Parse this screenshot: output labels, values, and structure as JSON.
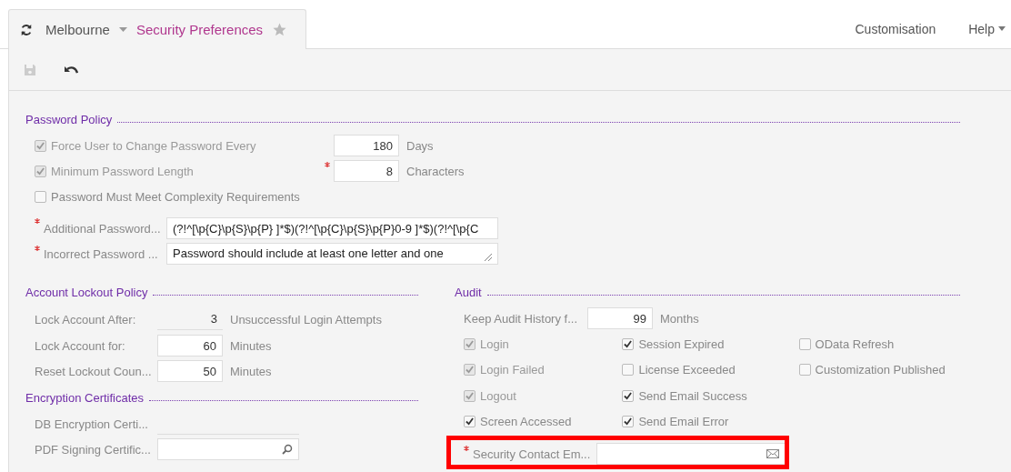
{
  "tab": {
    "location": "Melbourne",
    "title": "Security Preferences",
    "favorite": false
  },
  "top_links": [
    {
      "label": "Customisation",
      "kind": "link"
    },
    {
      "label": "Help",
      "kind": "menu"
    }
  ],
  "toolbar": {
    "save_disabled": true
  },
  "password_policy": {
    "title": "Password Policy",
    "options": [
      {
        "label": "Force User to Change Password Every",
        "checked": true,
        "disabled": true,
        "required": false,
        "value": "180",
        "unit": "Days"
      },
      {
        "label": "Minimum Password Length",
        "checked": true,
        "disabled": true,
        "required": true,
        "value": "8",
        "unit": "Characters"
      },
      {
        "label": "Password Must Meet Complexity Requirements",
        "checked": false,
        "disabled": false
      }
    ],
    "fields": [
      {
        "label": "Additional Password...",
        "required": true,
        "kind": "text",
        "value": "(?!^[\\p{C}\\p{S}\\p{P} ]*$)(?!^[\\p{C}\\p{S}\\p{P}0-9 ]*$)(?!^[\\p{C"
      },
      {
        "label": "Incorrect Password ...",
        "required": true,
        "kind": "textarea",
        "value": "Password should include at least one letter and one"
      }
    ]
  },
  "account_lockout": {
    "title": "Account Lockout Policy",
    "rows": [
      {
        "label": "Lock Account After:",
        "value": "3",
        "unit": "Unsuccessful Login Attempts",
        "kind": "readonly"
      },
      {
        "label": "Lock Account for:",
        "value": "60",
        "unit": "Minutes",
        "kind": "input"
      },
      {
        "label": "Reset Lockout Coun...",
        "value": "50",
        "unit": "Minutes",
        "kind": "input"
      }
    ]
  },
  "encryption": {
    "title": "Encryption Certificates",
    "rows": [
      {
        "label": "DB Encryption Certi...",
        "kind": "readonly"
      },
      {
        "label": "PDF Signing Certific...",
        "kind": "lookup"
      }
    ]
  },
  "audit": {
    "title": "Audit",
    "history": {
      "label": "Keep Audit History f...",
      "value": "99",
      "unit": "Months"
    },
    "event_columns": [
      [
        {
          "label": "Login",
          "checked": true,
          "disabled": true
        },
        {
          "label": "Login Failed",
          "checked": true,
          "disabled": true
        },
        {
          "label": "Logout",
          "checked": true,
          "disabled": true
        },
        {
          "label": "Screen Accessed",
          "checked": true,
          "disabled": false
        }
      ],
      [
        {
          "label": "Session Expired",
          "checked": true,
          "disabled": false
        },
        {
          "label": "License Exceeded",
          "checked": false,
          "disabled": false
        },
        {
          "label": "Send Email Success",
          "checked": true,
          "disabled": false
        },
        {
          "label": "Send Email Error",
          "checked": true,
          "disabled": false
        }
      ],
      [
        {
          "label": "OData Refresh",
          "checked": false,
          "disabled": false
        },
        {
          "label": "Customization Published",
          "checked": false,
          "disabled": false
        }
      ]
    ],
    "contact": {
      "label": "Security Contact Em...",
      "required": true,
      "highlighted": true
    }
  }
}
